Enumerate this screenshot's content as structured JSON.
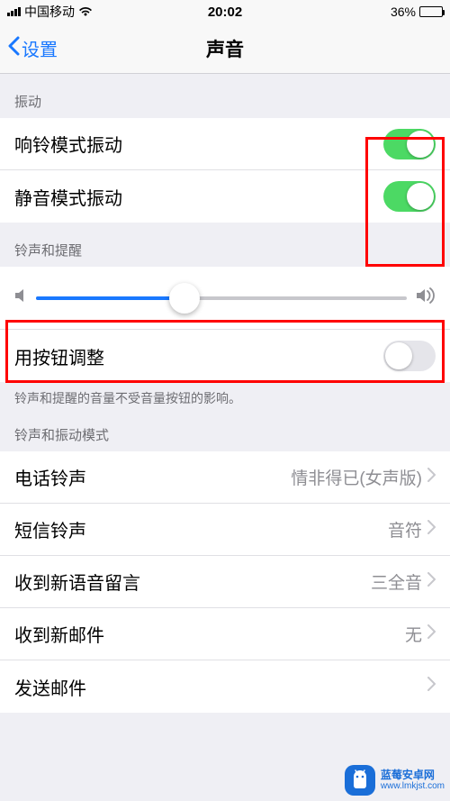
{
  "status": {
    "carrier": "中国移动",
    "time": "20:02",
    "battery_pct": "36%"
  },
  "nav": {
    "back_label": "设置",
    "title": "声音"
  },
  "sections": {
    "vibrate": {
      "header": "振动",
      "ring_label": "响铃模式振动",
      "ring_on": true,
      "silent_label": "静音模式振动",
      "silent_on": true
    },
    "ringer": {
      "header": "铃声和提醒",
      "slider_value": 0.4,
      "button_adjust_label": "用按钮调整",
      "button_adjust_on": false,
      "footer": "铃声和提醒的音量不受音量按钮的影响。"
    },
    "patterns": {
      "header": "铃声和振动模式",
      "phone_label": "电话铃声",
      "phone_value": "情非得已(女声版)",
      "sms_label": "短信铃声",
      "sms_value": "音符",
      "voicemail_label": "收到新语音留言",
      "voicemail_value": "三全音",
      "mail_label": "收到新邮件",
      "mail_value": "无",
      "sentmail_label": "发送邮件"
    }
  },
  "watermark": {
    "name": "蓝莓安卓网",
    "url": "www.lmkjst.com"
  }
}
